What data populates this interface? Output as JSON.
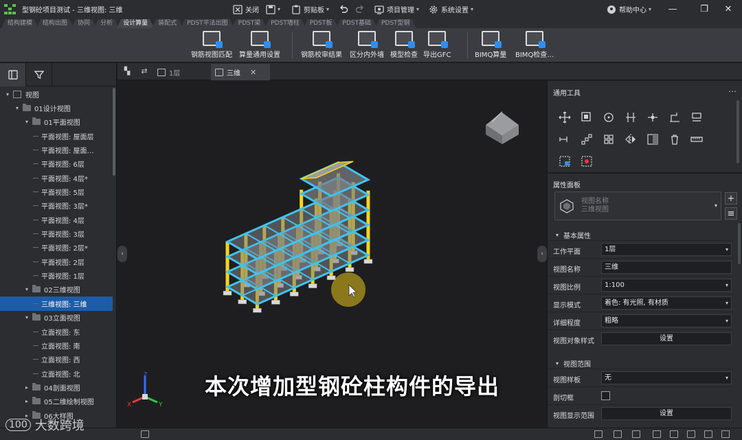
{
  "window": {
    "title": "型钢砼项目测试 - 三维视图: 三维",
    "close_label": "关闭",
    "clipboard_label": "剪贴板",
    "project_mgmt_label": "项目管理",
    "system_settings_label": "系统设置",
    "help_label": "帮助中心"
  },
  "ribbon": {
    "tabs": [
      "结构建模",
      "结构出图",
      "协同",
      "分析",
      "设计算量",
      "装配式",
      "PDST平法出图",
      "PDST梁",
      "PDST墙柱",
      "PDST板",
      "PDST基础",
      "PDST型钢"
    ],
    "active_tab": "设计算量",
    "buttons": [
      {
        "label": "钢筋视图匹配"
      },
      {
        "label": "算量通用设置"
      },
      {
        "label": "钢筋校审结果"
      },
      {
        "label": "区分内外墙"
      },
      {
        "label": "模型检查"
      },
      {
        "label": "导出GFC"
      },
      {
        "label": "BIMQ算量"
      },
      {
        "label": "BIMQ检查…"
      }
    ]
  },
  "tree": {
    "items": [
      {
        "label": "视图",
        "level": 0,
        "kind": "root",
        "expanded": true
      },
      {
        "label": "01设计视图",
        "level": 1,
        "kind": "folder",
        "expanded": true
      },
      {
        "label": "01平面视图",
        "level": 2,
        "kind": "folder",
        "expanded": true
      },
      {
        "label": "平面视图: 屋面层",
        "level": 3,
        "kind": "leaf"
      },
      {
        "label": "平面视图: 屋面…",
        "level": 3,
        "kind": "leaf"
      },
      {
        "label": "平面视图: 6层",
        "level": 3,
        "kind": "leaf"
      },
      {
        "label": "平面视图: 4层*",
        "level": 3,
        "kind": "leaf"
      },
      {
        "label": "平面视图: 5层",
        "level": 3,
        "kind": "leaf"
      },
      {
        "label": "平面视图: 3层*",
        "level": 3,
        "kind": "leaf"
      },
      {
        "label": "平面视图: 4层",
        "level": 3,
        "kind": "leaf"
      },
      {
        "label": "平面视图: 3层",
        "level": 3,
        "kind": "leaf"
      },
      {
        "label": "平面视图: 2层*",
        "level": 3,
        "kind": "leaf"
      },
      {
        "label": "平面视图: 2层",
        "level": 3,
        "kind": "leaf"
      },
      {
        "label": "平面视图: 1层",
        "level": 3,
        "kind": "leaf"
      },
      {
        "label": "02三维视图",
        "level": 2,
        "kind": "folder",
        "expanded": true
      },
      {
        "label": "三维视图: 三维",
        "level": 3,
        "kind": "leaf",
        "selected": true
      },
      {
        "label": "03立面视图",
        "level": 2,
        "kind": "folder",
        "expanded": true
      },
      {
        "label": "立面视图: 东",
        "level": 3,
        "kind": "leaf"
      },
      {
        "label": "立面视图: 南",
        "level": 3,
        "kind": "leaf"
      },
      {
        "label": "立面视图: 西",
        "level": 3,
        "kind": "leaf"
      },
      {
        "label": "立面视图: 北",
        "level": 3,
        "kind": "leaf"
      },
      {
        "label": "04剖面视图",
        "level": 2,
        "kind": "folder",
        "expanded": false
      },
      {
        "label": "05二维绘制视图",
        "level": 2,
        "kind": "folder",
        "expanded": false
      },
      {
        "label": "06大样图",
        "level": 2,
        "kind": "folder",
        "expanded": false
      }
    ]
  },
  "viewport": {
    "tabs": [
      {
        "label": "1层",
        "active": false
      },
      {
        "label": "三维",
        "active": true
      }
    ],
    "subtitle": "本次增加型钢砼柱构件的导出",
    "axes": {
      "x": "X",
      "y": "Y",
      "z": "Z"
    }
  },
  "tools_panel": {
    "title": "通用工具",
    "more": "…",
    "tools": [
      "move-icon",
      "copy-icon",
      "rotate-icon",
      "align-icon",
      "split-icon",
      "offset-icon",
      "trim-icon",
      "extend-icon",
      "array-icon",
      "group-icon",
      "mirror-icon",
      "grid-icon",
      "delete-icon",
      "measure-icon",
      "select-icon",
      "filter-icon"
    ]
  },
  "properties": {
    "title": "属性面板",
    "type_name": "视图名称",
    "type_value": "三维视图",
    "sections": {
      "basic": "基本属性",
      "range": "视图范围"
    },
    "rows": [
      {
        "label": "工作平面",
        "value": "1层",
        "kind": "select"
      },
      {
        "label": "视图名称",
        "value": "三维",
        "kind": "text"
      },
      {
        "label": "视图比例",
        "value": "1:100",
        "kind": "select"
      },
      {
        "label": "显示模式",
        "value": "着色: 有光照, 有材质",
        "kind": "select"
      },
      {
        "label": "详细程度",
        "value": "粗略",
        "kind": "select"
      },
      {
        "label": "视图对象样式",
        "value": "设置",
        "kind": "button"
      }
    ],
    "range_rows": [
      {
        "label": "视图样板",
        "value": "无",
        "kind": "select"
      },
      {
        "label": "剖切框",
        "value": "",
        "kind": "checkbox"
      },
      {
        "label": "视图显示范围",
        "value": "设置",
        "kind": "button"
      }
    ]
  },
  "watermark": "大数跨境",
  "colors": {
    "accent": "#1c5ca8",
    "beam": "#3ec3f0",
    "column": "#f5d516",
    "slab": "#7e8085"
  }
}
